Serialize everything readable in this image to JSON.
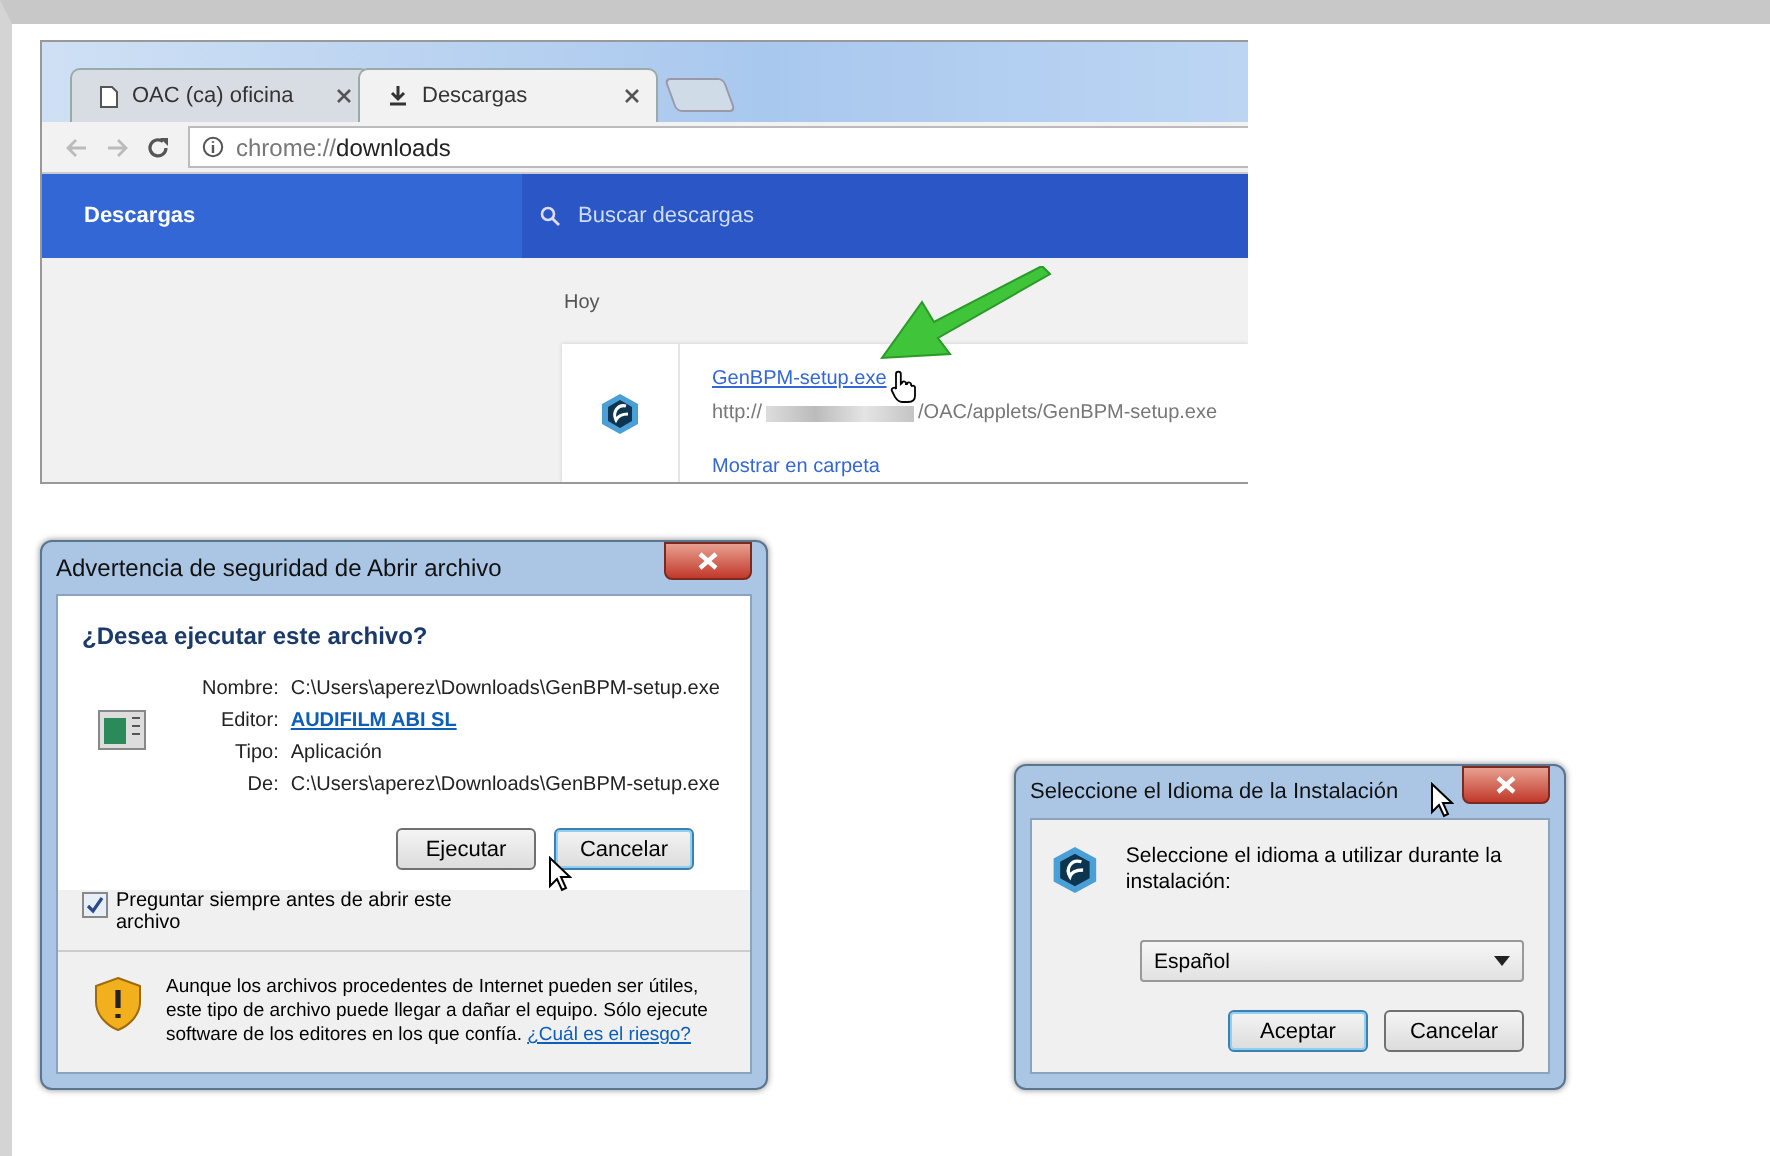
{
  "browser": {
    "tabs": [
      {
        "label": "OAC (ca) oficina",
        "selected": false
      },
      {
        "label": "Descargas",
        "selected": true
      }
    ],
    "address": {
      "scheme": "chrome://",
      "path": "downloads"
    },
    "header": {
      "title": "Descargas",
      "search_placeholder": "Buscar descargas"
    },
    "section": "Hoy",
    "download": {
      "file": "GenBPM-setup.exe",
      "url_start": "http://",
      "url_end": "/OAC/applets/GenBPM-setup.exe",
      "action": "Mostrar en carpeta"
    }
  },
  "security_dialog": {
    "title": "Advertencia de seguridad de Abrir archivo",
    "question": "¿Desea ejecutar este archivo?",
    "fields": [
      {
        "label": "Nombre:",
        "value": "C:\\Users\\aperez\\Downloads\\GenBPM-setup.exe",
        "kind": "text"
      },
      {
        "label": "Editor:",
        "value": "AUDIFILM ABI SL",
        "kind": "link"
      },
      {
        "label": "Tipo:",
        "value": "Aplicación",
        "kind": "text"
      },
      {
        "label": "De:",
        "value": "C:\\Users\\aperez\\Downloads\\GenBPM-setup.exe",
        "kind": "text"
      }
    ],
    "buttons": [
      "Ejecutar",
      "Cancelar"
    ],
    "checkbox": {
      "label": "Preguntar siempre antes de abrir este archivo",
      "checked": true
    },
    "warning": {
      "text": "Aunque los archivos procedentes de Internet pueden ser útiles, este tipo de archivo puede llegar a dañar el equipo. Sólo ejecute software de los editores en los que confía.",
      "link": "¿Cuál es el riesgo?"
    }
  },
  "language_dialog": {
    "title": "Seleccione el Idioma de la Instalación",
    "prompt": "Seleccione el idioma a utilizar durante la instalación:",
    "select": {
      "value": "Español"
    },
    "buttons": [
      "Aceptar",
      "Cancelar"
    ]
  }
}
